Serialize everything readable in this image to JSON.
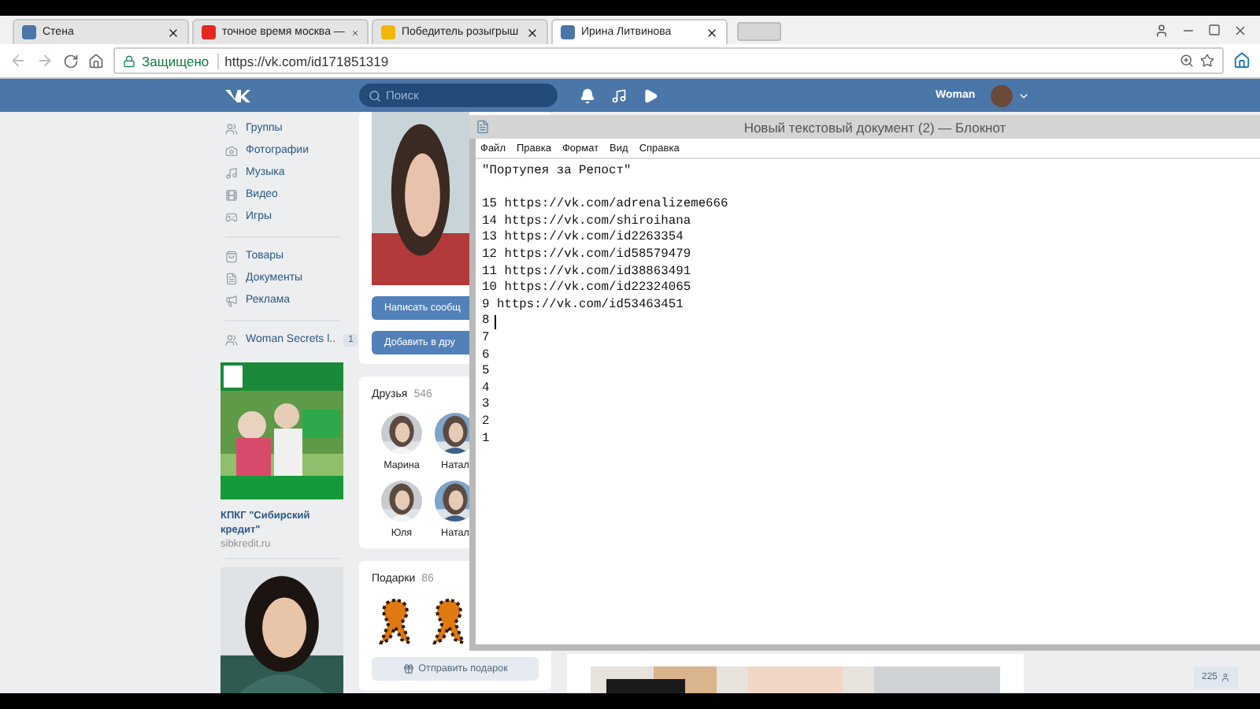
{
  "browser": {
    "tabs": [
      {
        "label": "Стена",
        "selected": false,
        "color": "#4a76a8"
      },
      {
        "label": "точное время москва —",
        "selected": false,
        "color": "#e52620"
      },
      {
        "label": "Победитель розыгрыш",
        "selected": false,
        "color": "#f2b705"
      },
      {
        "label": "Ирина Литвинова",
        "selected": true,
        "color": "#4a76a8"
      }
    ],
    "secure_label": "Защищено",
    "url": "https://vk.com/id171851319"
  },
  "vk_header": {
    "search": {
      "placeholder": "Поиск"
    },
    "user_name": "Woman"
  },
  "sidebar": {
    "sections": [
      {
        "items": [
          {
            "label": "Группы",
            "kind": "groups"
          },
          {
            "label": "Фотографии",
            "kind": "photos"
          },
          {
            "label": "Музыка",
            "kind": "music"
          },
          {
            "label": "Видео",
            "kind": "video"
          },
          {
            "label": "Игры",
            "kind": "games"
          }
        ]
      },
      {
        "items": [
          {
            "label": "Товары",
            "kind": "goods"
          },
          {
            "label": "Документы",
            "kind": "documents"
          },
          {
            "label": "Реклама",
            "kind": "ads"
          }
        ]
      },
      {
        "items": [
          {
            "label": "Woman Secrets l..",
            "kind": "groups",
            "badge": "1"
          }
        ]
      }
    ],
    "ad": {
      "title": "КПКГ \"Сибирский кредит\"",
      "domain": "sibkredit.ru"
    }
  },
  "profile": {
    "buttons": [
      "Написать сообщ",
      "Добавить в дру"
    ],
    "friends": {
      "title": "Друзья",
      "count": "546",
      "people": [
        {
          "name": "Марина"
        },
        {
          "name": "Натал"
        },
        {
          "name": "Юля"
        },
        {
          "name": "Натал"
        }
      ]
    },
    "gifts": {
      "title": "Подарки",
      "count": "86",
      "send_button": "Отправить подарок"
    }
  },
  "notepad": {
    "title": "Новый текстовый документ (2) — Блокнот",
    "menu": [
      "Файл",
      "Правка",
      "Формат",
      "Вид",
      "Справка"
    ],
    "heading": "\"Портупея за Репост\"",
    "entries": [
      {
        "text": "15 https://vk.com/adrenalizeme666",
        "caret": false
      },
      {
        "text": "14 https://vk.com/shiroihana",
        "caret": false
      },
      {
        "text": "13 https://vk.com/id2263354",
        "caret": false
      },
      {
        "text": "12 https://vk.com/id58579479",
        "caret": false
      },
      {
        "text": "11 https://vk.com/id38863491",
        "caret": false
      },
      {
        "text": "10 https://vk.com/id22324065",
        "caret": false
      },
      {
        "text": "9 https://vk.com/id53463451",
        "caret": false
      },
      {
        "text": "8",
        "caret": true
      },
      {
        "text": "7",
        "caret": false
      },
      {
        "text": "6",
        "caret": false
      },
      {
        "text": "5",
        "caret": false
      },
      {
        "text": "4",
        "caret": false
      },
      {
        "text": "3",
        "caret": false
      },
      {
        "text": "2",
        "caret": false
      },
      {
        "text": "1",
        "caret": false
      }
    ]
  },
  "online_count": "225"
}
